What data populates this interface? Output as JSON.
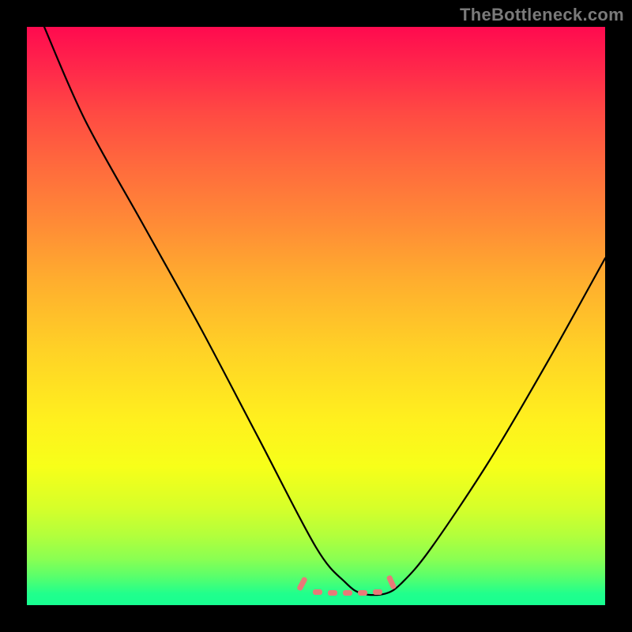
{
  "watermark": "TheBottleneck.com",
  "colors": {
    "black": "#000000",
    "curve": "#000000",
    "dash": "#e87a78",
    "gradient_top": "#ff0a4f",
    "gradient_bottom": "#17ff91"
  },
  "chart_data": {
    "type": "line",
    "title": "",
    "xlabel": "",
    "ylabel": "",
    "xlim": [
      0,
      100
    ],
    "ylim": [
      0,
      100
    ],
    "grid": false,
    "legend": false,
    "annotations": [
      {
        "kind": "dashed-segment",
        "approx_x_range": [
          48,
          65
        ],
        "approx_y": 2,
        "color": "#e87a78"
      }
    ],
    "series": [
      {
        "name": "curve",
        "x": [
          3,
          10,
          20,
          30,
          40,
          50,
          55,
          58,
          62,
          65,
          70,
          80,
          90,
          100
        ],
        "values": [
          100,
          84,
          66,
          48,
          29,
          10,
          4,
          2,
          2,
          4,
          10,
          25,
          42,
          60
        ]
      }
    ]
  }
}
